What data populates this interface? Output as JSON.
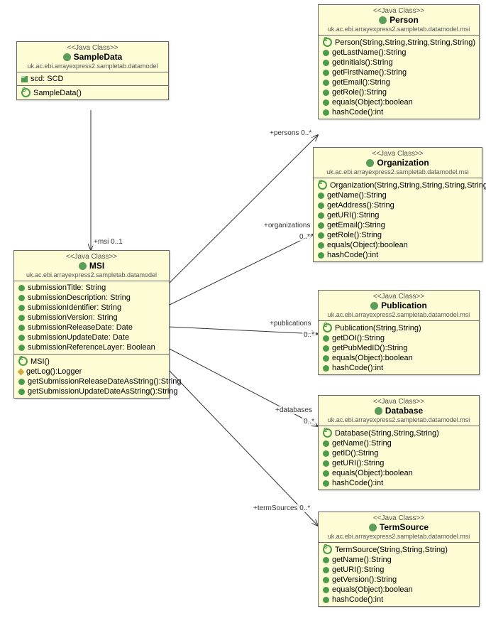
{
  "stereo": "<<Java Class>>",
  "classes": {
    "SampleData": {
      "name": "SampleData",
      "pkg": "uk.ac.ebi.arrayexpress2.sampletab.datamodel",
      "attrs": [
        {
          "i": "sf",
          "t": "scd: SCD"
        }
      ],
      "ops": [
        {
          "i": "cs",
          "t": "SampleData()"
        }
      ]
    },
    "MSI": {
      "name": "MSI",
      "pkg": "uk.ac.ebi.arrayexpress2.sampletab.datamodel",
      "attrs": [
        {
          "i": "g",
          "t": "submissionTitle: String"
        },
        {
          "i": "g",
          "t": "submissionDescription: String"
        },
        {
          "i": "g",
          "t": "submissionIdentifier: String"
        },
        {
          "i": "g",
          "t": "submissionVersion: String"
        },
        {
          "i": "g",
          "t": "submissionReleaseDate: Date"
        },
        {
          "i": "g",
          "t": "submissionUpdateDate: Date"
        },
        {
          "i": "g",
          "t": "submissionReferenceLayer: Boolean"
        }
      ],
      "ops": [
        {
          "i": "cs",
          "t": "MSI()"
        },
        {
          "i": "y",
          "t": "getLog():Logger"
        },
        {
          "i": "g",
          "t": "getSubmissionReleaseDateAsString():String"
        },
        {
          "i": "g",
          "t": "getSubmissionUpdateDateAsString():String"
        }
      ]
    },
    "Person": {
      "name": "Person",
      "pkg": "uk.ac.ebi.arrayexpress2.sampletab.datamodel.msi",
      "ops": [
        {
          "i": "cs",
          "t": "Person(String,String,String,String,String)"
        },
        {
          "i": "g",
          "t": "getLastName():String"
        },
        {
          "i": "g",
          "t": "getInitials():String"
        },
        {
          "i": "g",
          "t": "getFirstName():String"
        },
        {
          "i": "g",
          "t": "getEmail():String"
        },
        {
          "i": "g",
          "t": "getRole():String"
        },
        {
          "i": "g",
          "t": "equals(Object):boolean"
        },
        {
          "i": "g",
          "t": "hashCode():int"
        }
      ]
    },
    "Organization": {
      "name": "Organization",
      "pkg": "uk.ac.ebi.arrayexpress2.sampletab.datamodel.msi",
      "ops": [
        {
          "i": "cs",
          "t": "Organization(String,String,String,String,String)"
        },
        {
          "i": "g",
          "t": "getName():String"
        },
        {
          "i": "g",
          "t": "getAddress():String"
        },
        {
          "i": "g",
          "t": "getURI():String"
        },
        {
          "i": "g",
          "t": "getEmail():String"
        },
        {
          "i": "g",
          "t": "getRole():String"
        },
        {
          "i": "g",
          "t": "equals(Object):boolean"
        },
        {
          "i": "g",
          "t": "hashCode():int"
        }
      ]
    },
    "Publication": {
      "name": "Publication",
      "pkg": "uk.ac.ebi.arrayexpress2.sampletab.datamodel.msi",
      "ops": [
        {
          "i": "cs",
          "t": "Publication(String,String)"
        },
        {
          "i": "g",
          "t": "getDOI():String"
        },
        {
          "i": "g",
          "t": "getPubMedID():String"
        },
        {
          "i": "g",
          "t": "equals(Object):boolean"
        },
        {
          "i": "g",
          "t": "hashCode():int"
        }
      ]
    },
    "Database": {
      "name": "Database",
      "pkg": "uk.ac.ebi.arrayexpress2.sampletab.datamodel.msi",
      "ops": [
        {
          "i": "cs",
          "t": "Database(String,String,String)"
        },
        {
          "i": "g",
          "t": "getName():String"
        },
        {
          "i": "g",
          "t": "getID():String"
        },
        {
          "i": "g",
          "t": "getURI():String"
        },
        {
          "i": "g",
          "t": "equals(Object):boolean"
        },
        {
          "i": "g",
          "t": "hashCode():int"
        }
      ]
    },
    "TermSource": {
      "name": "TermSource",
      "pkg": "uk.ac.ebi.arrayexpress2.sampletab.datamodel.msi",
      "ops": [
        {
          "i": "cs",
          "t": "TermSource(String,String,String)"
        },
        {
          "i": "g",
          "t": "getName():String"
        },
        {
          "i": "g",
          "t": "getURI():String"
        },
        {
          "i": "g",
          "t": "getVersion():String"
        },
        {
          "i": "g",
          "t": "equals(Object):boolean"
        },
        {
          "i": "g",
          "t": "hashCode():int"
        }
      ]
    }
  },
  "assoc": {
    "msi": "+msi  0..1",
    "persons": "+persons  0..*",
    "organizations": "+organizations",
    "orgmult": "0..*",
    "publications": "+publications",
    "pubmult": "0..*",
    "databases": "+databases",
    "dbmult": "0..*",
    "termSources": "+termSources  0..*"
  },
  "chart_data": {
    "type": "uml-class-diagram",
    "classes": [
      "SampleData",
      "MSI",
      "Person",
      "Organization",
      "Publication",
      "Database",
      "TermSource"
    ],
    "associations": [
      {
        "from": "SampleData",
        "to": "MSI",
        "role": "msi",
        "mult": "0..1",
        "nav": "to"
      },
      {
        "from": "MSI",
        "to": "Person",
        "role": "persons",
        "mult": "0..*",
        "nav": "to"
      },
      {
        "from": "MSI",
        "to": "Organization",
        "role": "organizations",
        "mult": "0..*",
        "nav": "to"
      },
      {
        "from": "MSI",
        "to": "Publication",
        "role": "publications",
        "mult": "0..*",
        "nav": "to"
      },
      {
        "from": "MSI",
        "to": "Database",
        "role": "databases",
        "mult": "0..*",
        "nav": "to"
      },
      {
        "from": "MSI",
        "to": "TermSource",
        "role": "termSources",
        "mult": "0..*",
        "nav": "to"
      }
    ]
  }
}
